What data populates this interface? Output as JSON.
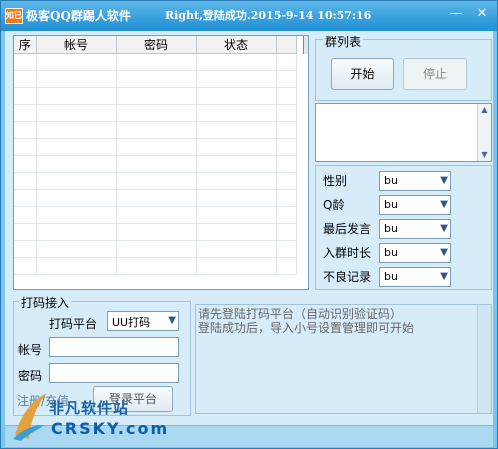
{
  "window": {
    "title": "极客QQ群踢人软件",
    "status": "Right,登陆成功.2015-9-14 10:57:16",
    "logo_text": "知已",
    "minimize_glyph": "—",
    "close_glyph": "✕"
  },
  "grid": {
    "columns": [
      "序",
      "帐号",
      "密码",
      "状态"
    ],
    "rows": []
  },
  "group": {
    "title": "群列表",
    "start_label": "开始",
    "stop_label": "停止",
    "scroll_up_glyph": "▲",
    "scroll_down_glyph": "▼"
  },
  "filters": [
    {
      "label": "性别",
      "value": "bu"
    },
    {
      "label": "Q龄",
      "value": "bu"
    },
    {
      "label": "最后发言",
      "value": "bu"
    },
    {
      "label": "入群时长",
      "value": "bu"
    },
    {
      "label": "不良记录",
      "value": "bu"
    }
  ],
  "captcha": {
    "title": "打码接入",
    "platform_label": "打码平台",
    "platform_value": "UU打码",
    "account_label": "帐号",
    "password_label": "密码",
    "register_link": "注册/充值",
    "login_label": "登录平台"
  },
  "log": {
    "lines": [
      "请先登陆打码平台（自动识别验证码）",
      "登陆成功后，导入小号设置管理即可开始"
    ]
  },
  "watermark": {
    "name": "非凡软件站",
    "domain": "CRSKY.com"
  },
  "colors": {
    "titlebar": "#1f8fd4",
    "window_bg": "#d6ecf8",
    "accent": "#2b7cb6"
  },
  "icons": {
    "dropdown": "chevron-down-icon",
    "app": "app-logo-icon"
  }
}
